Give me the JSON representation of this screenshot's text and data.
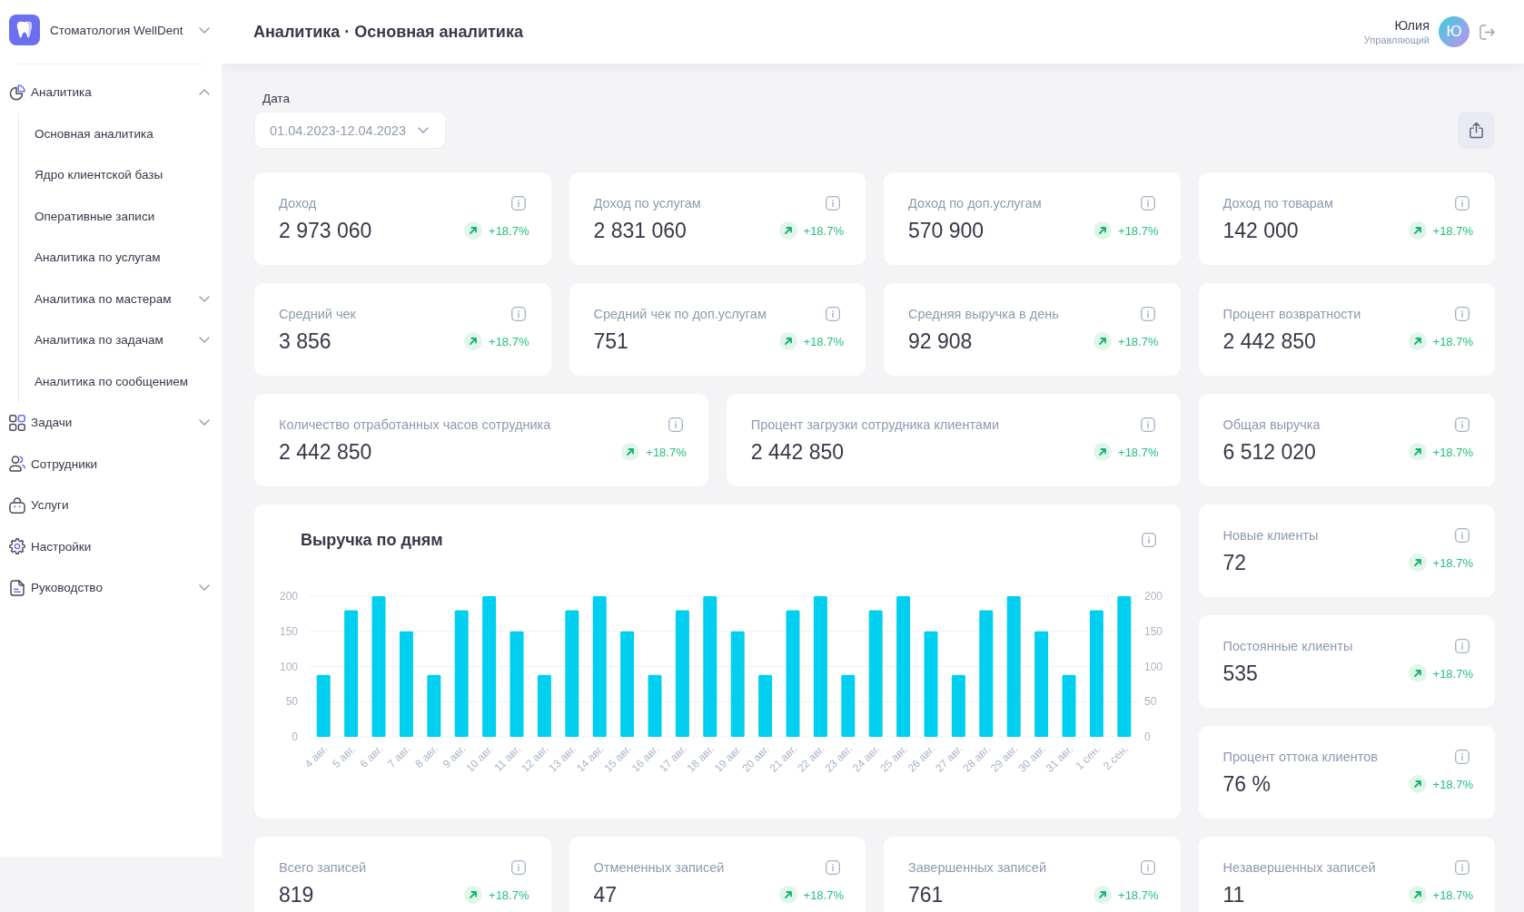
{
  "sidebar": {
    "clinic": "Стоматология WellDent",
    "nav": [
      {
        "label": "Аналитика",
        "kind": "group",
        "expanded": true,
        "children": [
          {
            "label": "Основная аналитика",
            "kind": "link"
          },
          {
            "label": "Ядро клиентской базы",
            "kind": "link"
          },
          {
            "label": "Оперативные записи",
            "kind": "link"
          },
          {
            "label": "Аналитика по услугам",
            "kind": "link"
          },
          {
            "label": "Аналитика по мастерам",
            "kind": "group",
            "expanded": false
          },
          {
            "label": "Аналитика по задачам",
            "kind": "group",
            "expanded": false
          },
          {
            "label": "Аналитика по сообщением",
            "kind": "link"
          }
        ]
      },
      {
        "label": "Задачи",
        "kind": "group",
        "expanded": false
      },
      {
        "label": "Сотрудники",
        "kind": "link"
      },
      {
        "label": "Услуги",
        "kind": "link"
      },
      {
        "label": "Настройки",
        "kind": "link"
      },
      {
        "label": "Руководство",
        "kind": "group",
        "expanded": false
      }
    ]
  },
  "header": {
    "title": "Аналитика · Основная аналитика",
    "user": {
      "name": "Юлия",
      "role": "Управляющий",
      "initial": "Ю"
    }
  },
  "filters": {
    "date": {
      "label": "Дата",
      "value": "01.04.2023-12.04.2023"
    }
  },
  "metric_rows": [
    [
      {
        "label": "Доход",
        "value": "2 973 060",
        "trend": "+18.7%",
        "rising": true
      },
      {
        "label": "Доход по услугам",
        "value": "2 831 060",
        "trend": "+18.7%",
        "rising": true
      },
      {
        "label": "Доход по доп.услугам",
        "value": "570 900",
        "trend": "+18.7%",
        "rising": true
      },
      {
        "label": "Доход по товарам",
        "value": "142 000",
        "trend": "+18.7%",
        "rising": true
      }
    ],
    [
      {
        "label": "Средний чек",
        "value": "3 856",
        "trend": "+18.7%",
        "rising": true
      },
      {
        "label": "Средний чек по доп.услугам",
        "value": "751",
        "trend": "+18.7%",
        "rising": true
      },
      {
        "label": "Средняя выручка в день",
        "value": "92 908",
        "trend": "+18.7%",
        "rising": true
      },
      {
        "label": "Процент возвратности",
        "value": "2 442 850",
        "trend": "+18.7%",
        "rising": true
      }
    ],
    [
      {
        "label": "Количество отработанных часов сотрудника",
        "value": "2 442 850",
        "trend": "+18.7%",
        "rising": true
      },
      {
        "label": "Процент загрузки сотрудника клиентами",
        "value": "2 442 850",
        "trend": "+18.7%",
        "rising": true
      },
      {
        "label": "Общая выручка",
        "value": "6 512 020",
        "trend": "+18.7%",
        "rising": true
      }
    ]
  ],
  "revenue_chart": {
    "chart_data": {
      "type": "bar",
      "title": "Выручка по дням",
      "categories": [
        "4 авг.",
        "5 авг.",
        "6 авг.",
        "7 авг.",
        "8 авг.",
        "9 авг.",
        "10 авг.",
        "11 авг.",
        "12 авг.",
        "13 авг.",
        "14 авг.",
        "15 авг.",
        "16 авг.",
        "17 авг.",
        "18 авг.",
        "19 авг.",
        "20 авг.",
        "21 авг.",
        "22 авг.",
        "23 авг.",
        "24 авг.",
        "25 авг.",
        "26 авг.",
        "27 авг.",
        "28 авг.",
        "29 авг.",
        "30 авг.",
        "31 авг.",
        "1 сен.",
        "2 сен."
      ],
      "values": [
        88,
        180,
        200,
        150,
        88,
        180,
        200,
        150,
        88,
        180,
        200,
        150,
        88,
        180,
        200,
        150,
        88,
        180,
        200,
        88,
        180,
        200,
        150,
        88,
        180,
        200,
        150,
        88,
        180,
        200
      ],
      "ylim": [
        0,
        200
      ],
      "yticks": [
        0,
        50,
        100,
        150,
        200
      ],
      "grid": true
    },
    "right_axis_labels": [
      "200",
      "150",
      "100",
      "50",
      "0"
    ]
  },
  "client_metrics": [
    {
      "label": "Новые клиенты",
      "value": "72",
      "trend": "+18.7%",
      "rising": true
    },
    {
      "label": "Постоянные клиенты",
      "value": "535",
      "trend": "+18.7%",
      "rising": true
    },
    {
      "label": "Процент оттока клиентов",
      "value": "76 %",
      "trend": "+18.7%",
      "rising": true
    }
  ],
  "record_metrics": [
    {
      "label": "Всего записей",
      "value": "819",
      "trend": "+18.7%",
      "rising": true
    },
    {
      "label": "Отмененных записей",
      "value": "47",
      "trend": "+18.7%",
      "rising": true
    },
    {
      "label": "Завершенных записей",
      "value": "761",
      "trend": "+18.7%",
      "rising": true
    },
    {
      "label": "Незавершенных записей",
      "value": "11",
      "trend": "+18.7%",
      "rising": true
    }
  ]
}
